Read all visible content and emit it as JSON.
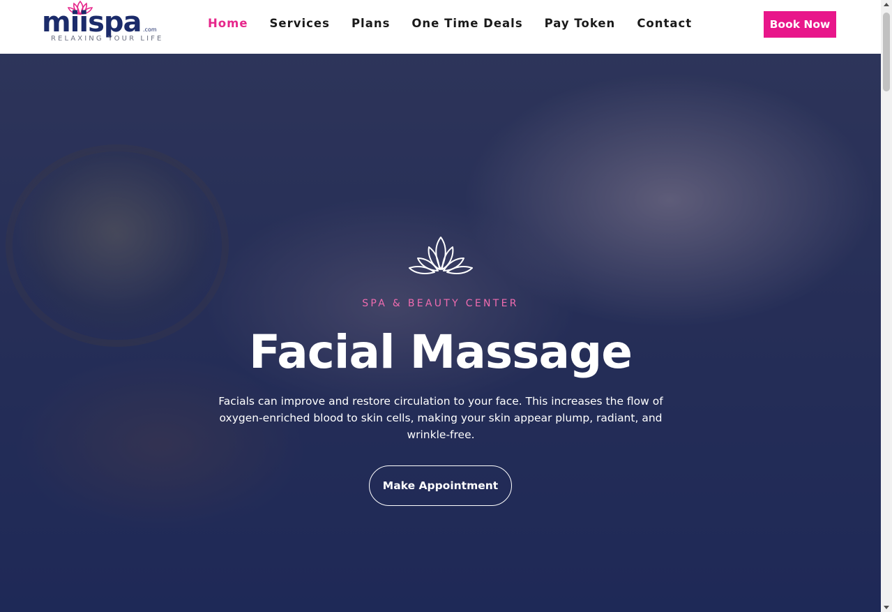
{
  "brand": {
    "name": "miispa",
    "domain_suffix": ".com",
    "tagline": "RELAXING YOUR LIFE",
    "primary_color": "#1b2b6a",
    "accent_color": "#e6278b",
    "logo_icon": "lotus-icon"
  },
  "nav": {
    "items": [
      {
        "label": "Home",
        "active": true
      },
      {
        "label": "Services",
        "active": false
      },
      {
        "label": "Plans",
        "active": false
      },
      {
        "label": "One Time Deals",
        "active": false
      },
      {
        "label": "Pay Token",
        "active": false
      },
      {
        "label": "Contact",
        "active": false
      }
    ],
    "book_label": "Book Now"
  },
  "hero": {
    "icon": "lotus-icon",
    "eyebrow": "SPA & BEAUTY CENTER",
    "title": "Facial Massage",
    "description": "Facials can improve and restore circulation to your face. This increases the flow of oxygen-enriched blood to skin cells, making your skin appear plump, radiant, and wrinkle-free.",
    "cta_label": "Make Appointment"
  }
}
